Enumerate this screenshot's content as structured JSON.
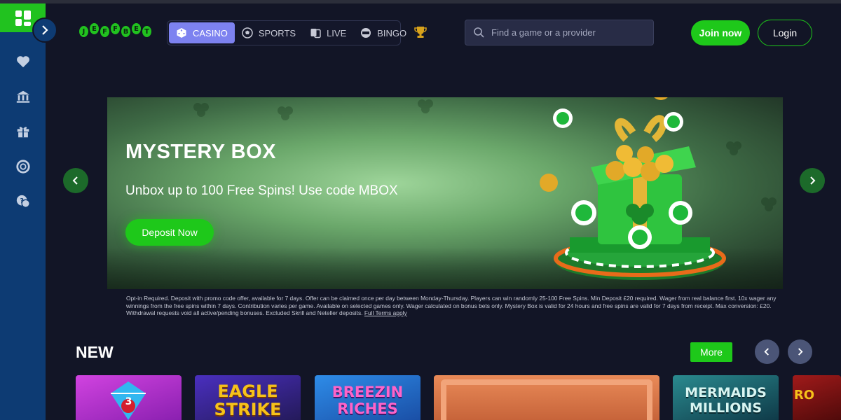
{
  "sidebar": {
    "icons": [
      "heart-icon",
      "bank-icon",
      "gift-icon",
      "lifebuoy-icon",
      "support-chat-icon"
    ]
  },
  "header": {
    "logo_letters": [
      "J",
      "E",
      "F",
      "F",
      "B",
      "E",
      "T"
    ],
    "nav": [
      {
        "label": "CASINO",
        "icon": "dice-icon",
        "active": true
      },
      {
        "label": "SPORTS",
        "icon": "football-icon",
        "active": false
      },
      {
        "label": "LIVE",
        "icon": "cards-icon",
        "active": false
      },
      {
        "label": "BINGO",
        "icon": "bingo-ball-icon",
        "active": false
      }
    ],
    "search_placeholder": "Find a game or a provider",
    "join_label": "Join now",
    "login_label": "Login"
  },
  "banner": {
    "title": "MYSTERY BOX",
    "subtitle": "Unbox up to 100 Free Spins! Use code MBOX",
    "cta": "Deposit Now"
  },
  "terms": {
    "text": "Opt-in Required. Deposit with promo code offer, available for 7 days. Offer can be claimed once per day between Monday-Thursday. Players can win randomly 25-100 Free Spins. Min Deposit £20 required. Wager from real balance first. 10x wager any winnings from the free spins within 7 days. Contribution varies per game. Available on selected games only. Wager calculated on bonus bets only. Mystery Box is valid for 24 hours and free spins are valid for 7 days from receipt. Max conversion: £20. Withdrawal requests void all active/pending bonuses. Excluded Skrill and Neteller deposits.",
    "link": "Full Terms apply"
  },
  "new_section": {
    "title": "NEW",
    "more_label": "More",
    "games": [
      {
        "title": "3",
        "bg": "#c23bd6"
      },
      {
        "title": "EAGLE STRIKE",
        "bg": "#3a2a8f"
      },
      {
        "title": "BREEZIN RICHES",
        "bg": "#1f6fd1"
      },
      {
        "title": "",
        "bg": "#d9784a"
      },
      {
        "title": "MERMAIDS MILLIONS",
        "bg": "#1a5f6b"
      },
      {
        "title": "RO",
        "bg": "#7a1010"
      }
    ]
  },
  "colors": {
    "brand_green": "#1ec81a",
    "sidebar_blue": "#0d3b73",
    "background": "#121526",
    "nav_active": "#7d82f0"
  }
}
